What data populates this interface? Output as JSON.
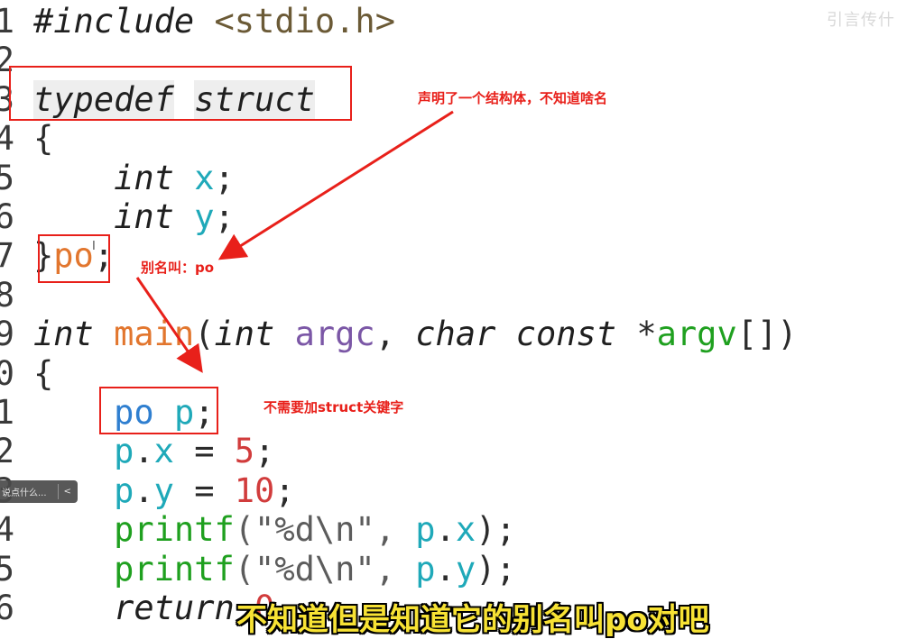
{
  "watermark": "引言传什",
  "code": {
    "lines": [
      {
        "n": "1",
        "parts": [
          {
            "t": "#include",
            "c": "it"
          },
          {
            "t": " <stdio.h>",
            "c": "olive"
          }
        ]
      },
      {
        "n": "2",
        "parts": []
      },
      {
        "n": "3",
        "parts": [
          {
            "t": "typedef",
            "c": "it kwbg"
          },
          {
            "t": " ",
            "c": "dark"
          },
          {
            "t": "struct",
            "c": "it kwbg"
          }
        ]
      },
      {
        "n": "4",
        "parts": [
          {
            "t": "{",
            "c": "dark"
          }
        ]
      },
      {
        "n": "5",
        "parts": [
          {
            "t": "    ",
            "c": "dark"
          },
          {
            "t": "int",
            "c": "it"
          },
          {
            "t": " x",
            "c": "teal"
          },
          {
            "t": ";",
            "c": "dark"
          }
        ]
      },
      {
        "n": "6",
        "parts": [
          {
            "t": "    ",
            "c": "dark"
          },
          {
            "t": "int",
            "c": "it"
          },
          {
            "t": " y",
            "c": "teal"
          },
          {
            "t": ";",
            "c": "dark"
          }
        ]
      },
      {
        "n": "7",
        "parts": [
          {
            "t": "}",
            "c": "dark"
          },
          {
            "t": "po",
            "c": "orange"
          },
          {
            "t": ";",
            "c": "dark"
          }
        ]
      },
      {
        "n": "8",
        "parts": []
      },
      {
        "n": "9",
        "parts": [
          {
            "t": "int",
            "c": "it"
          },
          {
            "t": " main",
            "c": "orange"
          },
          {
            "t": "(",
            "c": "dark"
          },
          {
            "t": "int",
            "c": "it"
          },
          {
            "t": " argc",
            "c": "purple"
          },
          {
            "t": ", ",
            "c": "dark"
          },
          {
            "t": "char",
            "c": "it"
          },
          {
            "t": " ",
            "c": "dark"
          },
          {
            "t": "const",
            "c": "it"
          },
          {
            "t": " *",
            "c": "dark"
          },
          {
            "t": "argv",
            "c": "green"
          },
          {
            "t": "[])",
            "c": "dark"
          }
        ]
      },
      {
        "n": "0",
        "parts": [
          {
            "t": "{",
            "c": "dark"
          }
        ]
      },
      {
        "n": "1",
        "parts": [
          {
            "t": "    ",
            "c": "dark"
          },
          {
            "t": "po",
            "c": "blue"
          },
          {
            "t": " p",
            "c": "teal"
          },
          {
            "t": ";",
            "c": "dark"
          }
        ]
      },
      {
        "n": "2",
        "parts": [
          {
            "t": "    ",
            "c": "dark"
          },
          {
            "t": "p",
            "c": "teal"
          },
          {
            "t": ".",
            "c": "dark"
          },
          {
            "t": "x",
            "c": "teal"
          },
          {
            "t": " = ",
            "c": "dark"
          },
          {
            "t": "5",
            "c": "red"
          },
          {
            "t": ";",
            "c": "dark"
          }
        ]
      },
      {
        "n": "3",
        "parts": [
          {
            "t": "    ",
            "c": "dark"
          },
          {
            "t": "p",
            "c": "teal"
          },
          {
            "t": ".",
            "c": "dark"
          },
          {
            "t": "y",
            "c": "teal"
          },
          {
            "t": " = ",
            "c": "dark"
          },
          {
            "t": "10",
            "c": "red"
          },
          {
            "t": ";",
            "c": "dark"
          }
        ]
      },
      {
        "n": "4",
        "parts": [
          {
            "t": "    ",
            "c": "dark"
          },
          {
            "t": "printf",
            "c": "green"
          },
          {
            "t": "(\"%d\\n\", ",
            "c": "str"
          },
          {
            "t": "p",
            "c": "teal"
          },
          {
            "t": ".",
            "c": "dark"
          },
          {
            "t": "x",
            "c": "teal"
          },
          {
            "t": ");",
            "c": "dark"
          }
        ]
      },
      {
        "n": "5",
        "parts": [
          {
            "t": "    ",
            "c": "dark"
          },
          {
            "t": "printf",
            "c": "green"
          },
          {
            "t": "(\"%d\\n\", ",
            "c": "str"
          },
          {
            "t": "p",
            "c": "teal"
          },
          {
            "t": ".",
            "c": "dark"
          },
          {
            "t": "y",
            "c": "teal"
          },
          {
            "t": ");",
            "c": "dark"
          }
        ]
      },
      {
        "n": "6",
        "parts": [
          {
            "t": "    ",
            "c": "dark"
          },
          {
            "t": "return",
            "c": "it"
          },
          {
            "t": " 0",
            "c": "red"
          }
        ]
      }
    ]
  },
  "annotations": {
    "typedef_note": "声明了一个结构体，不知道啥名",
    "alias_note": "别名叫：po",
    "no_struct_note": "不需要加struct关键字"
  },
  "tooltip": {
    "text": "说点什么...",
    "chevron": "<"
  },
  "subtitle": "不知道但是知道它的别名叫po对吧"
}
